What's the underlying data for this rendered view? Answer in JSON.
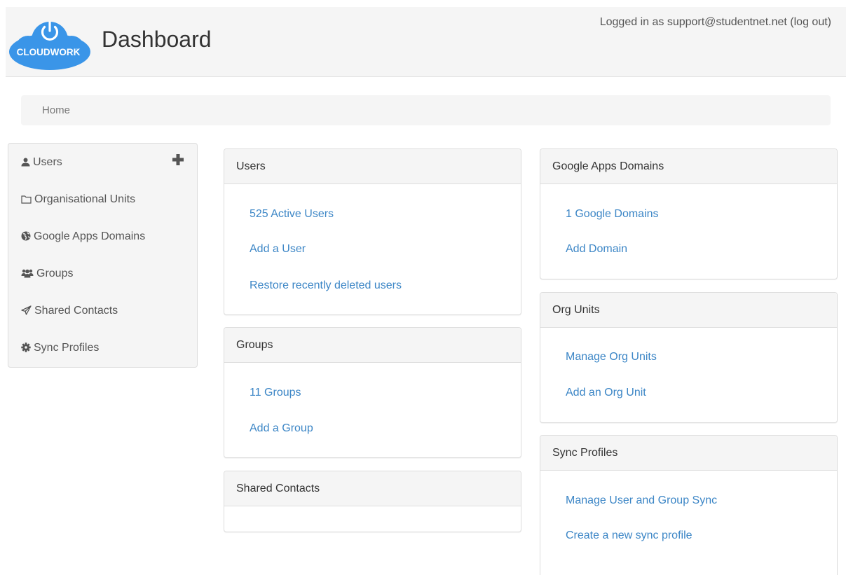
{
  "header": {
    "logo_text": "CLOUDWORK",
    "title": "Dashboard",
    "login_prefix": "Logged in as support@studentnet.net",
    "logout_label": "(log out)"
  },
  "breadcrumb": {
    "home": "Home"
  },
  "sidebar": {
    "items": [
      {
        "label": "Users",
        "icon": "user-icon"
      },
      {
        "label": "Organisational Units",
        "icon": "folder-icon"
      },
      {
        "label": "Google Apps Domains",
        "icon": "globe-icon"
      },
      {
        "label": "Groups",
        "icon": "users-icon"
      },
      {
        "label": "Shared Contacts",
        "icon": "paper-plane-icon"
      },
      {
        "label": "Sync Profiles",
        "icon": "gear-icon"
      }
    ],
    "add_icon": "plus-icon"
  },
  "panels": {
    "users": {
      "title": "Users",
      "links": [
        "525 Active Users",
        "Add a User",
        "Restore recently deleted users"
      ]
    },
    "groups": {
      "title": "Groups",
      "links": [
        "11 Groups",
        "Add a Group"
      ]
    },
    "shared_contacts": {
      "title": "Shared Contacts"
    },
    "google_domains": {
      "title": "Google Apps Domains",
      "links": [
        "1 Google Domains",
        "Add Domain"
      ]
    },
    "org_units": {
      "title": "Org Units",
      "links": [
        "Manage Org Units",
        "Add an Org Unit"
      ]
    },
    "sync_profiles": {
      "title": "Sync Profiles",
      "links": [
        "Manage User and Group Sync",
        "Create a new sync profile"
      ]
    }
  },
  "colors": {
    "link": "#3c86c6",
    "logo_blue": "#3a95e8",
    "panel_heading_bg": "#f5f5f5"
  }
}
